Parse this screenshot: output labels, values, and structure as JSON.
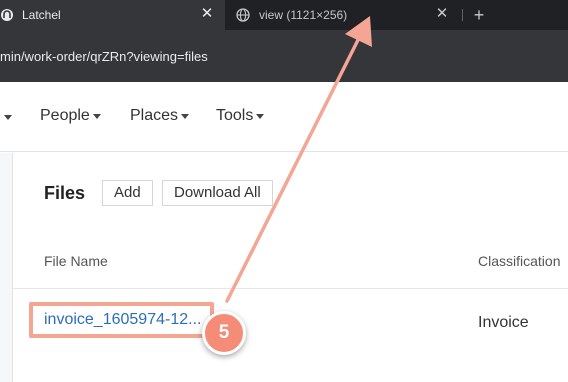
{
  "browser": {
    "tabs": [
      {
        "title": "Latchel",
        "active": true
      },
      {
        "title": "view (1121×256)",
        "active": false
      }
    ],
    "close_glyph": "✕",
    "new_tab_glyph": "+",
    "url": "min/work-order/qrZRn?viewing=files"
  },
  "nav": {
    "items": [
      {
        "label": "People"
      },
      {
        "label": "Places"
      },
      {
        "label": "Tools"
      }
    ]
  },
  "files": {
    "title": "Files",
    "add_label": "Add",
    "download_all_label": "Download All",
    "columns": {
      "file_name": "File Name",
      "classification": "Classification"
    },
    "rows": [
      {
        "file_name": "invoice_1605974-12...",
        "classification": "Invoice"
      }
    ]
  },
  "annotation": {
    "step_number": "5",
    "color": "#f48c77"
  }
}
